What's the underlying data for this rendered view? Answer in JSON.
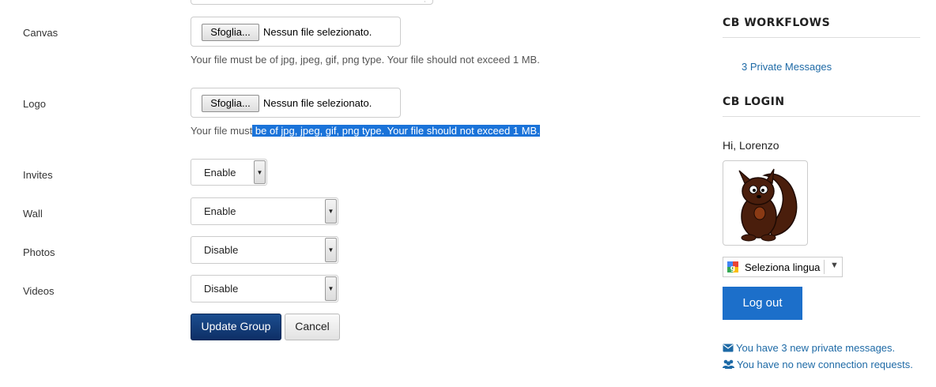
{
  "form": {
    "canvas": {
      "label": "Canvas",
      "browse_label": "Sfoglia...",
      "file_status": "Nessun file selezionato.",
      "hint": "Your file must be of jpg, jpeg, gif, png type. Your file should not exceed 1 MB."
    },
    "logo": {
      "label": "Logo",
      "browse_label": "Sfoglia...",
      "file_status": "Nessun file selezionato.",
      "hint_unselected": "Your file must",
      "hint_selected": " be of jpg, jpeg, gif, png type. Your file should not exceed 1 MB."
    },
    "invites": {
      "label": "Invites",
      "value": "Enable"
    },
    "wall": {
      "label": "Wall",
      "value": "Enable"
    },
    "photos": {
      "label": "Photos",
      "value": "Disable"
    },
    "videos": {
      "label": "Videos",
      "value": "Disable"
    },
    "update_label": "Update Group",
    "cancel_label": "Cancel"
  },
  "sidebar": {
    "workflows": {
      "title": "CB WORKFLOWS",
      "private_messages_link": "3 Private Messages"
    },
    "login": {
      "title": "CB LOGIN",
      "greeting": "Hi, Lorenzo",
      "language_label": "Seleziona lingua",
      "logout_label": "Log out",
      "messages_notice": "You have 3 new private messages.",
      "connections_notice": "You have no new connection requests."
    }
  },
  "colors": {
    "primary_button": "#1b4d8f",
    "logout_button": "#1c6fca",
    "link": "#1e6aa6",
    "selection": "#1a73d9"
  },
  "icons": {
    "envelope": "envelope-icon",
    "users": "users-icon",
    "google": "google-translate-icon",
    "avatar": "squirrel-avatar"
  }
}
